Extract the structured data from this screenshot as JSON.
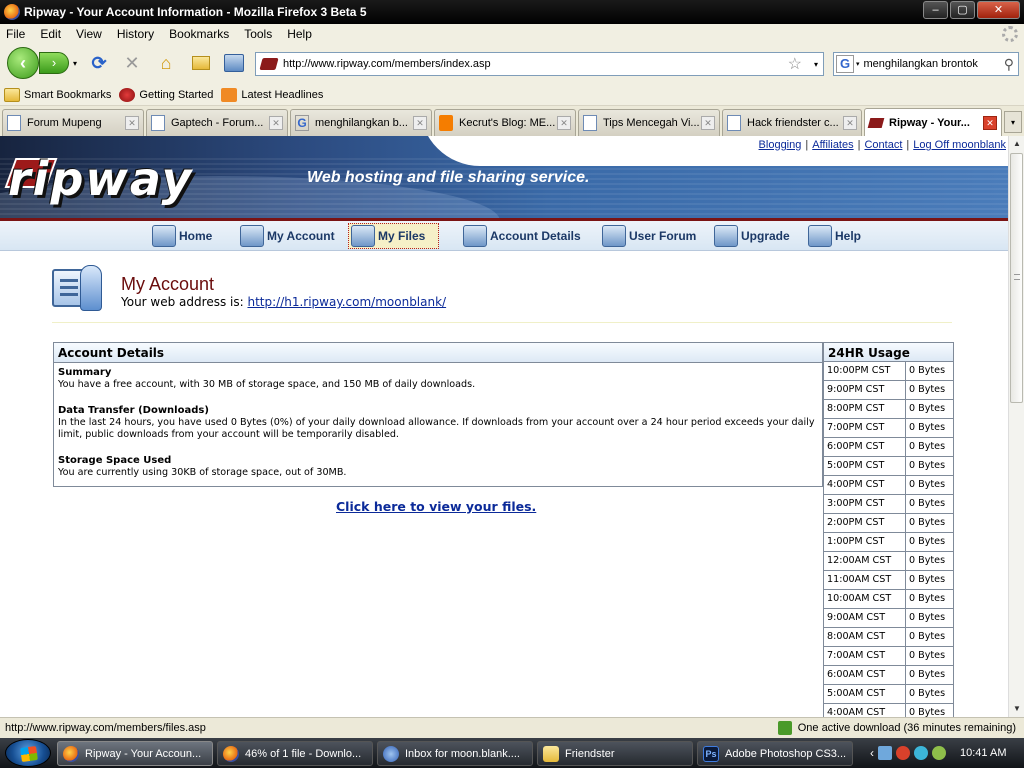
{
  "window": {
    "title": "Ripway - Your Account Information - Mozilla Firefox 3 Beta 5",
    "controls": {
      "minimize": "–",
      "maximize": "▢",
      "close": "✕"
    }
  },
  "menu": [
    "File",
    "Edit",
    "View",
    "History",
    "Bookmarks",
    "Tools",
    "Help"
  ],
  "toolbar": {
    "back": "‹",
    "forward": "›",
    "dropdown": "▾",
    "reload": "⟳",
    "stop": "✕",
    "home": "⌂",
    "url": "http://www.ripway.com/members/index.asp",
    "star": "☆",
    "search_engine": "G",
    "search_query": "menghilangkan brontok",
    "search_icon": "⚲"
  },
  "bookmarks": [
    {
      "label": "Smart Bookmarks",
      "icon": "folder-icon"
    },
    {
      "label": "Getting Started",
      "icon": "getting-started-icon"
    },
    {
      "label": "Latest Headlines",
      "icon": "rss-icon"
    }
  ],
  "tabs": [
    {
      "label": "Forum Mupeng",
      "icon": "page"
    },
    {
      "label": "Gaptech - Forum...",
      "icon": "page"
    },
    {
      "label": "menghilangkan b...",
      "icon": "google"
    },
    {
      "label": "Kecrut's Blog: ME...",
      "icon": "blogger"
    },
    {
      "label": "Tips Mencegah Vi...",
      "icon": "page"
    },
    {
      "label": "Hack friendster c...",
      "icon": "page"
    },
    {
      "label": "Ripway - Your...",
      "icon": "ripway",
      "active": true
    }
  ],
  "tab_close": "✕",
  "tab_list": "▾",
  "site": {
    "logo": "ripway",
    "tagline": "Web hosting and file sharing service.",
    "top_links": [
      "Blogging",
      "Affiliates",
      "Contact",
      "Log Off moonblank"
    ],
    "nav": [
      {
        "label": "Home",
        "name": "home"
      },
      {
        "label": "My Account",
        "name": "my-account"
      },
      {
        "label": "My Files",
        "name": "my-files",
        "selected": true
      },
      {
        "label": "Account Details",
        "name": "account-details"
      },
      {
        "label": "User Forum",
        "name": "user-forum"
      },
      {
        "label": "Upgrade",
        "name": "upgrade"
      },
      {
        "label": "Help",
        "name": "help"
      }
    ]
  },
  "account": {
    "title": "My Account",
    "web_address_label": "Your web address is: ",
    "web_address": "http://h1.ripway.com/moonblank/",
    "details_header": "Account Details",
    "sections": [
      {
        "heading": "Summary",
        "text": "You have a free account, with 30 MB of storage space, and 150 MB of daily downloads."
      },
      {
        "heading": "Data Transfer (Downloads)",
        "text": "In the last 24 hours, you have used 0 Bytes (0%) of your daily download allowance. If downloads from your account over a 24 hour period exceeds your daily limit, public downloads from your account will be temporarily disabled."
      },
      {
        "heading": "Storage Space Used",
        "text": "You are currently using 30KB of storage space, out of 30MB."
      }
    ],
    "view_files_link": "Click here to view your files."
  },
  "usage": {
    "header": "24HR Usage",
    "rows": [
      {
        "time": "10:00PM CST",
        "value": "0 Bytes"
      },
      {
        "time": "9:00PM CST",
        "value": "0 Bytes"
      },
      {
        "time": "8:00PM CST",
        "value": "0 Bytes"
      },
      {
        "time": "7:00PM CST",
        "value": "0 Bytes"
      },
      {
        "time": "6:00PM CST",
        "value": "0 Bytes"
      },
      {
        "time": "5:00PM CST",
        "value": "0 Bytes"
      },
      {
        "time": "4:00PM CST",
        "value": "0 Bytes"
      },
      {
        "time": "3:00PM CST",
        "value": "0 Bytes"
      },
      {
        "time": "2:00PM CST",
        "value": "0 Bytes"
      },
      {
        "time": "1:00PM CST",
        "value": "0 Bytes"
      },
      {
        "time": "12:00AM CST",
        "value": "0 Bytes"
      },
      {
        "time": "11:00AM CST",
        "value": "0 Bytes"
      },
      {
        "time": "10:00AM CST",
        "value": "0 Bytes"
      },
      {
        "time": "9:00AM CST",
        "value": "0 Bytes"
      },
      {
        "time": "8:00AM CST",
        "value": "0 Bytes"
      },
      {
        "time": "7:00AM CST",
        "value": "0 Bytes"
      },
      {
        "time": "6:00AM CST",
        "value": "0 Bytes"
      },
      {
        "time": "5:00AM CST",
        "value": "0 Bytes"
      },
      {
        "time": "4:00AM CST",
        "value": "0 Bytes"
      }
    ]
  },
  "scrollbar": {
    "up": "▲",
    "down": "▼"
  },
  "status": {
    "text": "http://www.ripway.com/members/files.asp",
    "download": "One active download (36 minutes remaining)"
  },
  "taskbar": {
    "items": [
      {
        "label": "Ripway - Your Accoun...",
        "icon": "ff",
        "active": true
      },
      {
        "label": "46% of 1 file - Downlo...",
        "icon": "ff"
      },
      {
        "label": "Inbox for moon.blank....",
        "icon": "tb"
      },
      {
        "label": "Friendster",
        "icon": "fd"
      },
      {
        "label": "Adobe Photoshop CS3...",
        "icon": "ps"
      }
    ],
    "clock": "10:41 AM",
    "tray_arrow": "‹"
  },
  "colors": {
    "brand_red": "#7a1414",
    "link_blue": "#0b2a99",
    "nav_text": "#1b3866"
  }
}
